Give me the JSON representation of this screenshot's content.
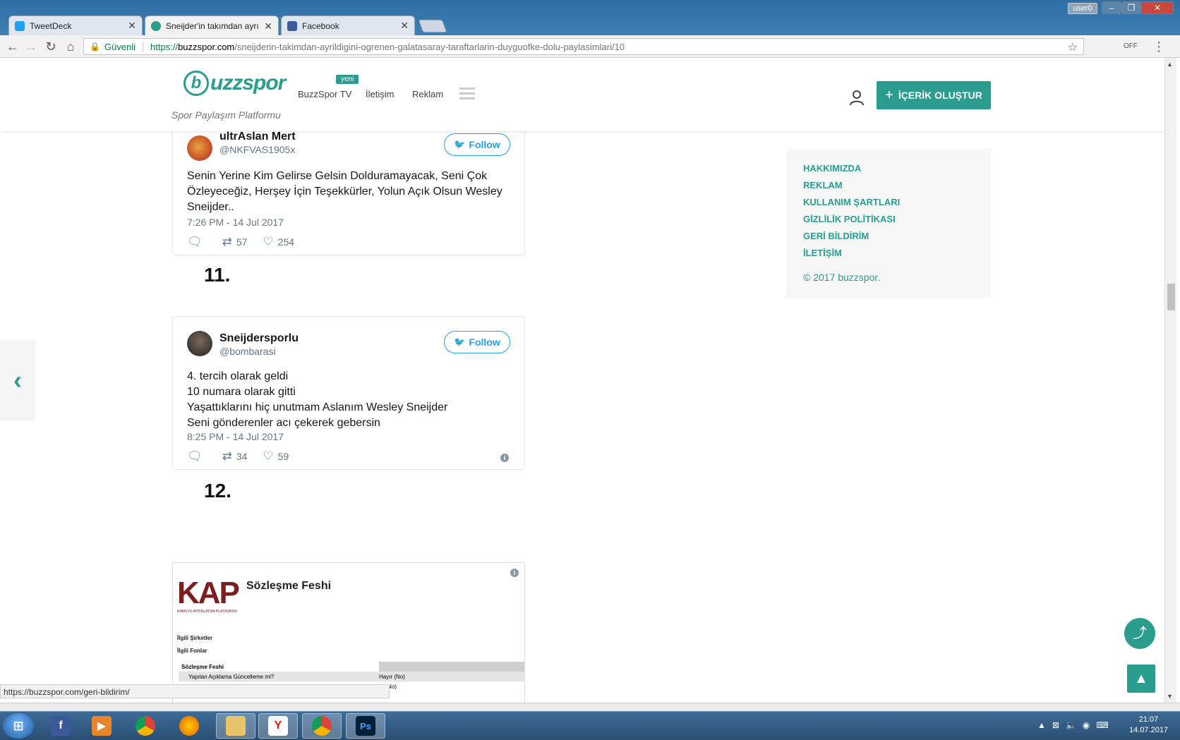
{
  "browser": {
    "tabs": [
      {
        "label": "TweetDeck",
        "color": "#1da1f2"
      },
      {
        "label": "Sneijder'in takımdan ayrı",
        "color": "#2a9d8f"
      },
      {
        "label": "Facebook",
        "color": "#3b5998"
      }
    ],
    "window_user": "user0",
    "secure_label": "Güvenli",
    "url_scheme": "https://",
    "url_domain": "buzzspor.com",
    "url_path": "/sneijderin-takimdan-ayrildigini-ogrenen-galatasaray-taraftarlarin-duyguofke-dolu-paylasimlari/10",
    "status_url": "https://buzzspor.com/geri-bildirim/"
  },
  "header": {
    "logo_letter": "b",
    "logo_text": "uzzspor",
    "tagline": "Spor Paylaşım Platformu",
    "badge": "yeni",
    "nav": [
      "BuzzSpor TV",
      "İletişim",
      "Reklam"
    ],
    "create_button": "İÇERİK OLUŞTUR",
    "accent_color": "#2a9d8f"
  },
  "tweets": [
    {
      "name": "ultrAslan Mert",
      "handle": "@NKFVAS1905x",
      "follow": "Follow",
      "lines": [
        "Senin Yerine Kim Gelirse Gelsin Dolduramayacak, Seni Çok",
        "Özleyeceğiz, Herşey İçin Teşekkürler, Yolun Açık Olsun Wesley",
        "Sneijder.."
      ],
      "time": "7:26 PM - 14 Jul 2017",
      "retweets": "57",
      "likes": "254"
    },
    {
      "name": "Sneijdersporlu",
      "handle": "@bombarasi",
      "follow": "Follow",
      "lines": [
        "4. tercih olarak geldi",
        "10 numara olarak gitti",
        "Yaşattıklarını hiç unutmam Aslanım Wesley Sneijder",
        "Seni gönderenler acı çekerek gebersin"
      ],
      "time": "8:25 PM - 14 Jul 2017",
      "retweets": "34",
      "likes": "59"
    }
  ],
  "numbers": [
    "11.",
    "12."
  ],
  "kap": {
    "logo": "KAP",
    "logo_sub": "KAMUYU AYDINLATMA PLATFORMU",
    "title": "Sözleşme Feshi",
    "row1": "İlgili Şirketler",
    "row2": "İlgili Fonlar",
    "table_header": "Sözleşme Feshi",
    "table_row_label": "Yapılan Açıklama Güncelleme mi?",
    "table_row_value": "Hayır (No)",
    "table_row2_value": "er (No)"
  },
  "sidebar": {
    "links": [
      "HAKKIMIZDA",
      "REKLAM",
      "KULLANIM ŞARTLARI",
      "GİZLİLİK POLİTİKASI",
      "GERİ BİLDİRİM",
      "İLETİŞİM"
    ],
    "copyright": "© 2017 buzzspor."
  },
  "taskbar": {
    "time": "21:07",
    "date": "14.07.2017",
    "apps": [
      "facebook",
      "media-player",
      "chrome",
      "firefox",
      "file-explorer",
      "yandex",
      "chrome-active",
      "photoshop"
    ]
  }
}
